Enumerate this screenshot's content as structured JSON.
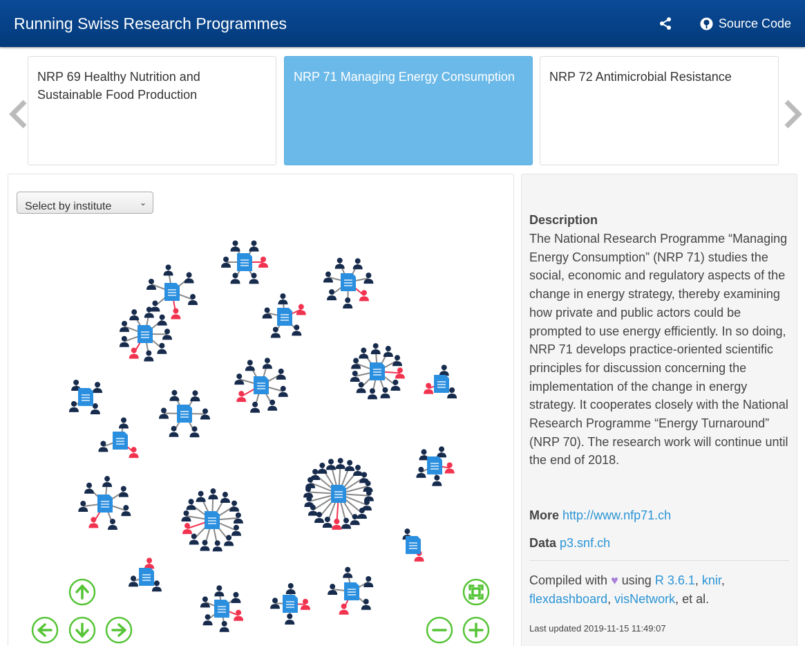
{
  "navbar": {
    "title": "Running Swiss Research Programmes",
    "share_icon": "share-icon",
    "source_label": "Source Code",
    "source_icon": "github-icon"
  },
  "carousel": {
    "cards": [
      {
        "label": "NRP 69 Healthy Nutrition and Sustainable Food Production",
        "active": false
      },
      {
        "label": "NRP 71 Managing Energy Consumption",
        "active": true
      },
      {
        "label": "NRP 72 Antimicrobial Resistance",
        "active": false
      }
    ],
    "prev_icon": "chevron-left-icon",
    "next_icon": "chevron-right-icon"
  },
  "network": {
    "select_placeholder": "Select by institute",
    "controls": [
      "arrow-up-icon",
      "arrow-left-icon",
      "arrow-down-icon",
      "arrow-right-icon",
      "fit-icon",
      "zoom-out-icon",
      "zoom-in-icon"
    ]
  },
  "description": {
    "heading": "Description",
    "text": "The National Research Programme “Managing Energy Consumption” (NRP 71) studies the social, economic and regulatory aspects of the change in energy strategy, thereby examining how private and public actors could be prompted to use energy efficiently. In so doing, NRP 71 develops practice-oriented scientific principles for discussion concerning the implementation of the change in energy strategy. It cooperates closely with the National Research Programme “Energy Turnaround” (NRP 70). The research work will continue until the end of 2018."
  },
  "more": {
    "label": "More",
    "link": "http://www.nfp71.ch"
  },
  "data": {
    "label": "Data",
    "link": "p3.snf.ch"
  },
  "credits": {
    "compiled": "Compiled with",
    "using": "using",
    "r": "R 3.6.1",
    "knir": "knir",
    "flex": "flexdashboard",
    "vis": "visNetwork",
    "etal": ", et al.",
    "updated": "Last updated 2019-11-15 11:49:07"
  },
  "colors": {
    "navbar": "#0a4a97",
    "active_card": "#6bb9e8",
    "doc": "#2b8fe0",
    "person": "#172b4d",
    "person_highlight": "#f2334f",
    "control": "#55c436",
    "link": "#2a94d6"
  }
}
